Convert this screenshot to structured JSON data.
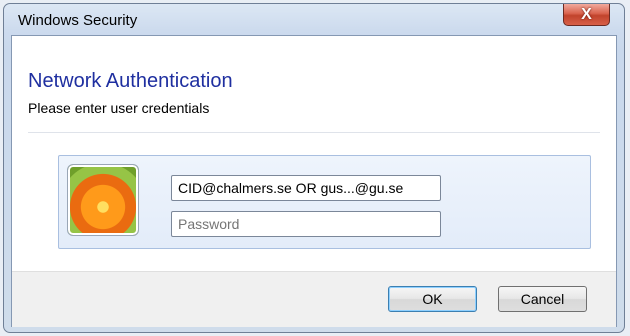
{
  "window": {
    "title": "Windows Security",
    "close_label": "X"
  },
  "main": {
    "heading": "Network Authentication",
    "subheading": "Please enter user credentials"
  },
  "credentials": {
    "username_value": "CID@chalmers.se OR gus...@gu.se",
    "password_placeholder": "Password"
  },
  "buttons": {
    "ok_label": "OK",
    "cancel_label": "Cancel"
  },
  "colors": {
    "heading": "#1f2fa0",
    "close_button": "#c1432c",
    "panel": "#e3ecf9"
  },
  "icons": {
    "avatar": "user-flower-icon",
    "close": "close-icon"
  }
}
